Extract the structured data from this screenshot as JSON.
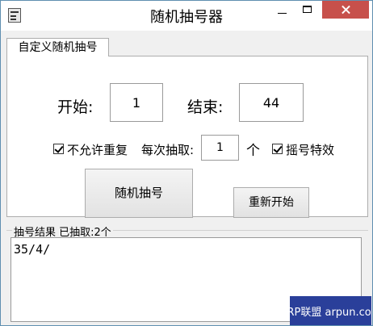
{
  "window": {
    "title": "随机抽号器"
  },
  "tab": {
    "label": "自定义随机抽号"
  },
  "range": {
    "start_label": "开始:",
    "start_value": "1",
    "end_label": "结束:",
    "end_value": "44"
  },
  "options": {
    "no_repeat_label": "不允许重复",
    "no_repeat_checked": true,
    "per_draw_label": "每次抽取:",
    "per_draw_value": "1",
    "per_draw_unit": "个",
    "effect_label": "摇号特效",
    "effect_checked": true
  },
  "buttons": {
    "draw": "随机抽号",
    "restart": "重新开始"
  },
  "results": {
    "group_label": "抽号结果   已抽取:2个",
    "text": "35/4/"
  },
  "watermark": {
    "text": "ARP联盟 arpun.com"
  }
}
